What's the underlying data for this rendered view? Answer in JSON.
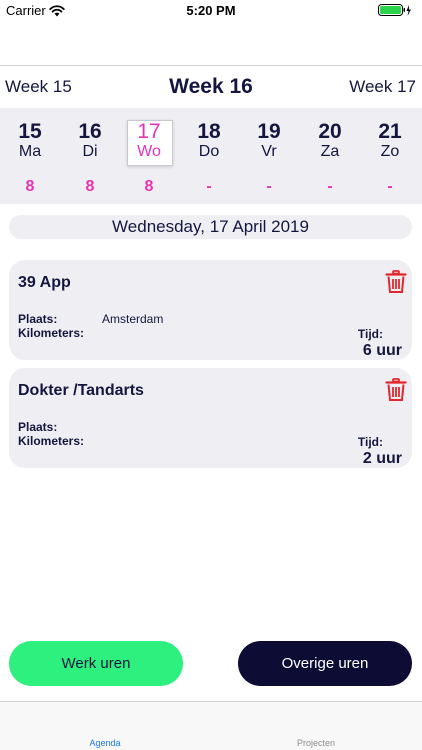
{
  "status_bar": {
    "carrier": "Carrier",
    "time": "5:20 PM",
    "battery_color": "#2bd44c"
  },
  "week_nav": {
    "prev": "Week 15",
    "current": "Week 16",
    "next": "Week 17"
  },
  "days": [
    {
      "num": "15",
      "name": "Ma",
      "hours": "8",
      "selected": false
    },
    {
      "num": "16",
      "name": "Di",
      "hours": "8",
      "selected": false
    },
    {
      "num": "17",
      "name": "Wo",
      "hours": "8",
      "selected": true
    },
    {
      "num": "18",
      "name": "Do",
      "hours": "-",
      "selected": false
    },
    {
      "num": "19",
      "name": "Vr",
      "hours": "-",
      "selected": false
    },
    {
      "num": "20",
      "name": "Za",
      "hours": "-",
      "selected": false
    },
    {
      "num": "21",
      "name": "Zo",
      "hours": "-",
      "selected": false
    }
  ],
  "selected_date": "Wednesday, 17 April 2019",
  "entries": [
    {
      "title": "39 App",
      "plaats_label": "Plaats:",
      "plaats_value": "Amsterdam",
      "km_label": "Kilometers:",
      "tijd_label": "Tijd:",
      "tijd_value": "6 uur"
    },
    {
      "title": "Dokter /Tandarts",
      "plaats_label": "Plaats:",
      "plaats_value": "",
      "km_label": "Kilometers:",
      "tijd_label": "Tijd:",
      "tijd_value": "2 uur"
    }
  ],
  "buttons": {
    "werk": "Werk uren",
    "overige": "Overige uren"
  },
  "tabs": {
    "agenda": "Agenda",
    "projecten": "Projecten"
  },
  "colors": {
    "accent_pink": "#e434b5",
    "navy": "#14163f",
    "green_button": "#2ef07e",
    "dark_button": "#0c0c34",
    "trash_red": "#e0282e",
    "tab_active": "#1e7ae8"
  }
}
